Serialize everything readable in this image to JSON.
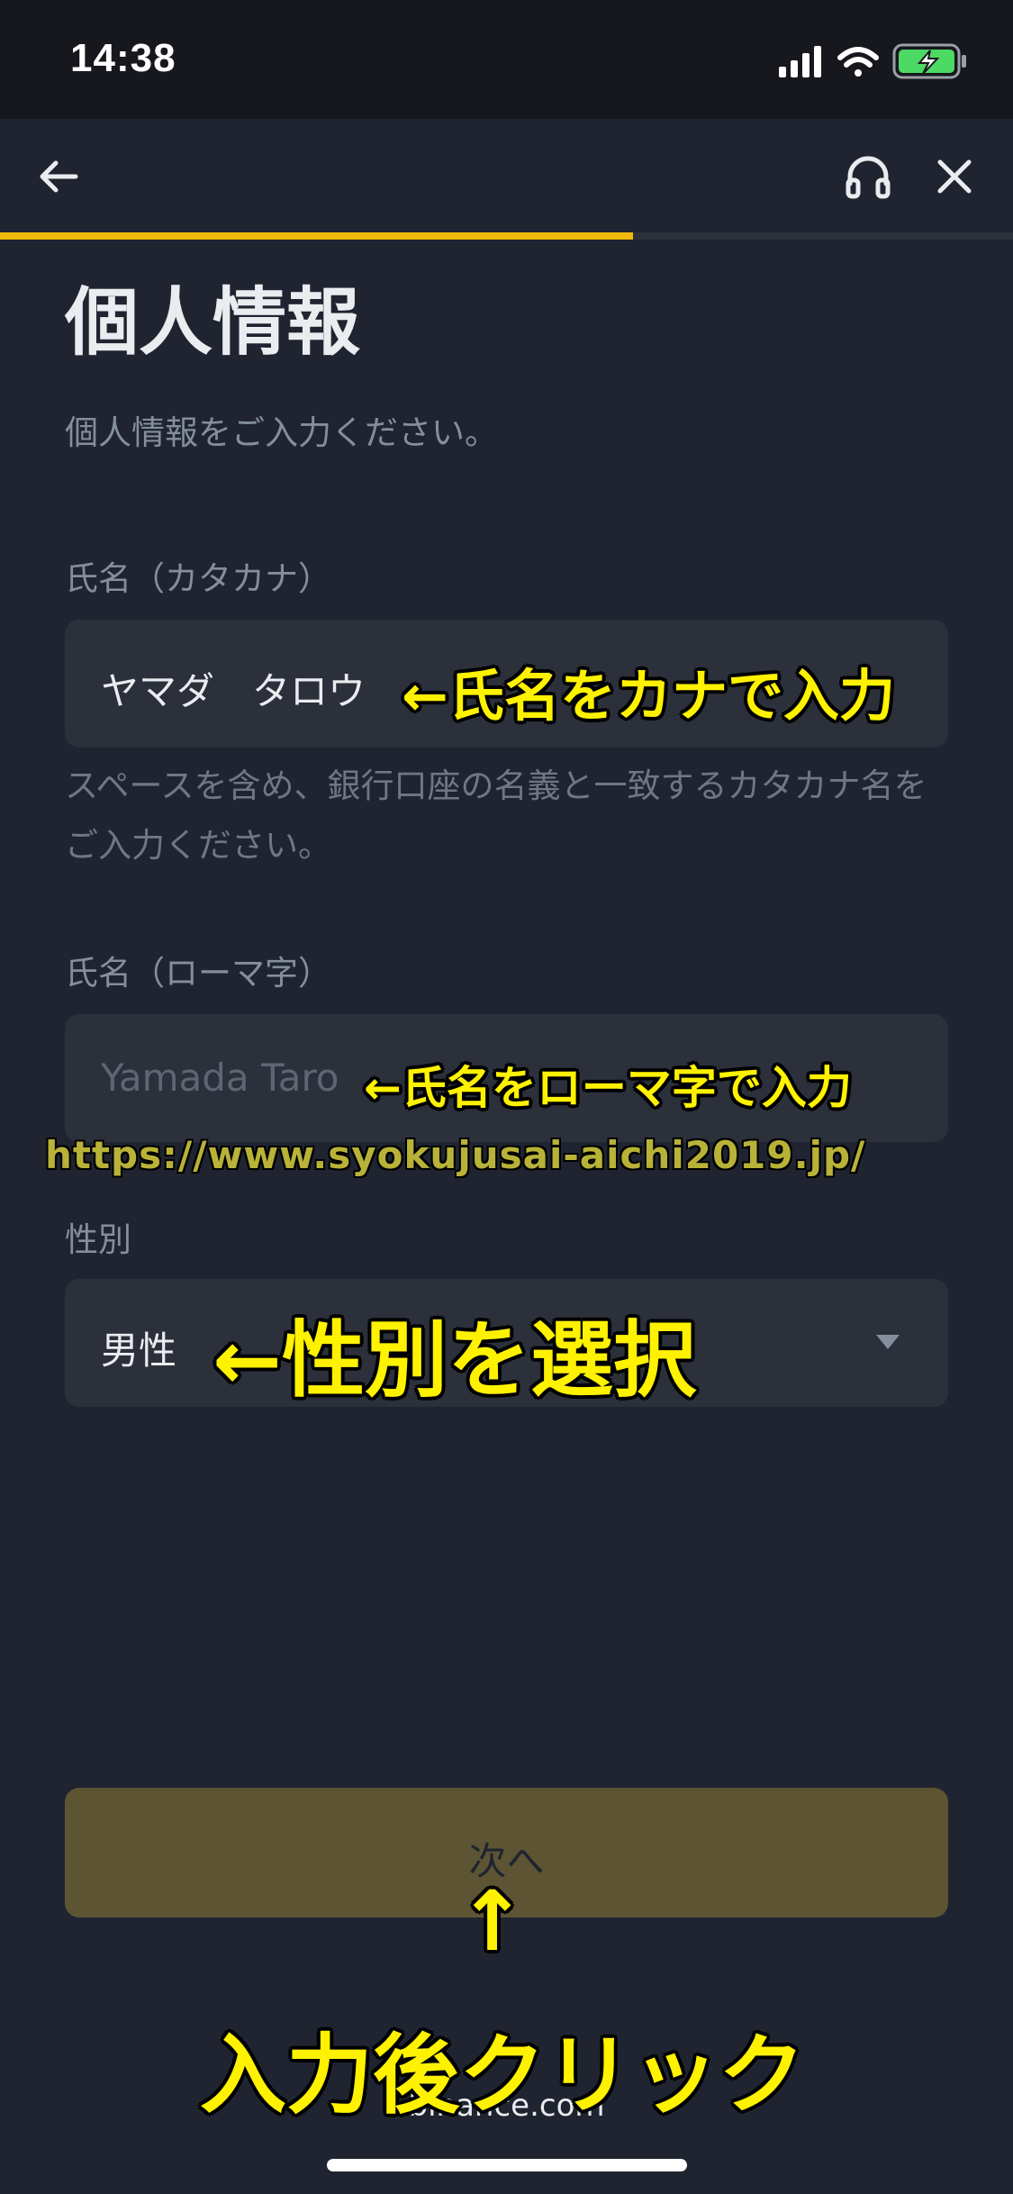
{
  "status_bar": {
    "time": "14:38"
  },
  "nav": {
    "back_icon": "arrow-left-icon",
    "support_icon": "headset-icon",
    "close_icon": "close-icon"
  },
  "progress": {
    "fraction": 0.5
  },
  "page": {
    "title": "個人情報",
    "subtitle": "個人情報をご入力ください。"
  },
  "form": {
    "name_kana": {
      "label": "氏名（カタカナ）",
      "value": "ヤマダ　タロウ",
      "helper": "スペースを含め、銀行口座の名義と一致するカタカナ名をご入力ください。"
    },
    "name_roman": {
      "label": "氏名（ローマ字）",
      "placeholder": "Yamada Taro"
    },
    "gender": {
      "label": "性別",
      "value": "男性"
    }
  },
  "next_button": {
    "label": "次へ"
  },
  "footer": {
    "domain": "binance.com"
  },
  "annotations": {
    "kana_hint": "←氏名をカナで入力",
    "roman_hint": "←氏名をローマ字で入力",
    "url": "https://www.syokujusai-aichi2019.jp/",
    "gender_hint": "←性別を選択",
    "arrow_up": "↑",
    "click_hint": "入力後クリック"
  },
  "colors": {
    "accent": "#f0b90b",
    "annotation": "#fff200",
    "background": "#1f2430"
  }
}
